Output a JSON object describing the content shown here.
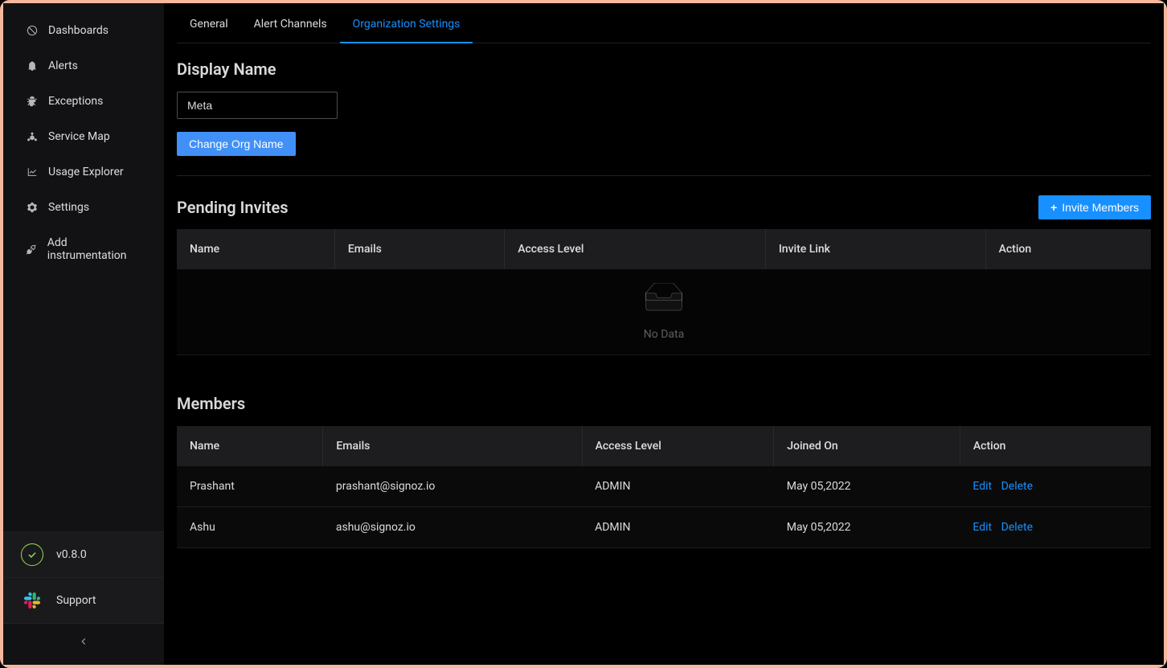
{
  "sidebar": {
    "items": [
      {
        "label": "Dashboards",
        "icon": "dashboard"
      },
      {
        "label": "Alerts",
        "icon": "alert"
      },
      {
        "label": "Exceptions",
        "icon": "bug"
      },
      {
        "label": "Service Map",
        "icon": "deployment"
      },
      {
        "label": "Usage Explorer",
        "icon": "line-chart"
      },
      {
        "label": "Settings",
        "icon": "setting"
      },
      {
        "label": "Add instrumentation",
        "icon": "api"
      }
    ],
    "version": "v0.8.0",
    "support": "Support"
  },
  "tabs": [
    {
      "label": "General",
      "active": false
    },
    {
      "label": "Alert Channels",
      "active": false
    },
    {
      "label": "Organization Settings",
      "active": true
    }
  ],
  "display_name_section": {
    "title": "Display Name",
    "value": "Meta",
    "button": "Change Org Name"
  },
  "pending_invites": {
    "title": "Pending Invites",
    "invite_button": "Invite Members",
    "columns": [
      "Name",
      "Emails",
      "Access Level",
      "Invite Link",
      "Action"
    ],
    "empty_text": "No Data"
  },
  "members": {
    "title": "Members",
    "columns": [
      "Name",
      "Emails",
      "Access Level",
      "Joined On",
      "Action"
    ],
    "rows": [
      {
        "name": "Prashant",
        "email": "prashant@signoz.io",
        "access": "ADMIN",
        "joined": "May 05,2022"
      },
      {
        "name": "Ashu",
        "email": "ashu@signoz.io",
        "access": "ADMIN",
        "joined": "May 05,2022"
      }
    ],
    "actions": {
      "edit": "Edit",
      "delete": "Delete"
    }
  }
}
